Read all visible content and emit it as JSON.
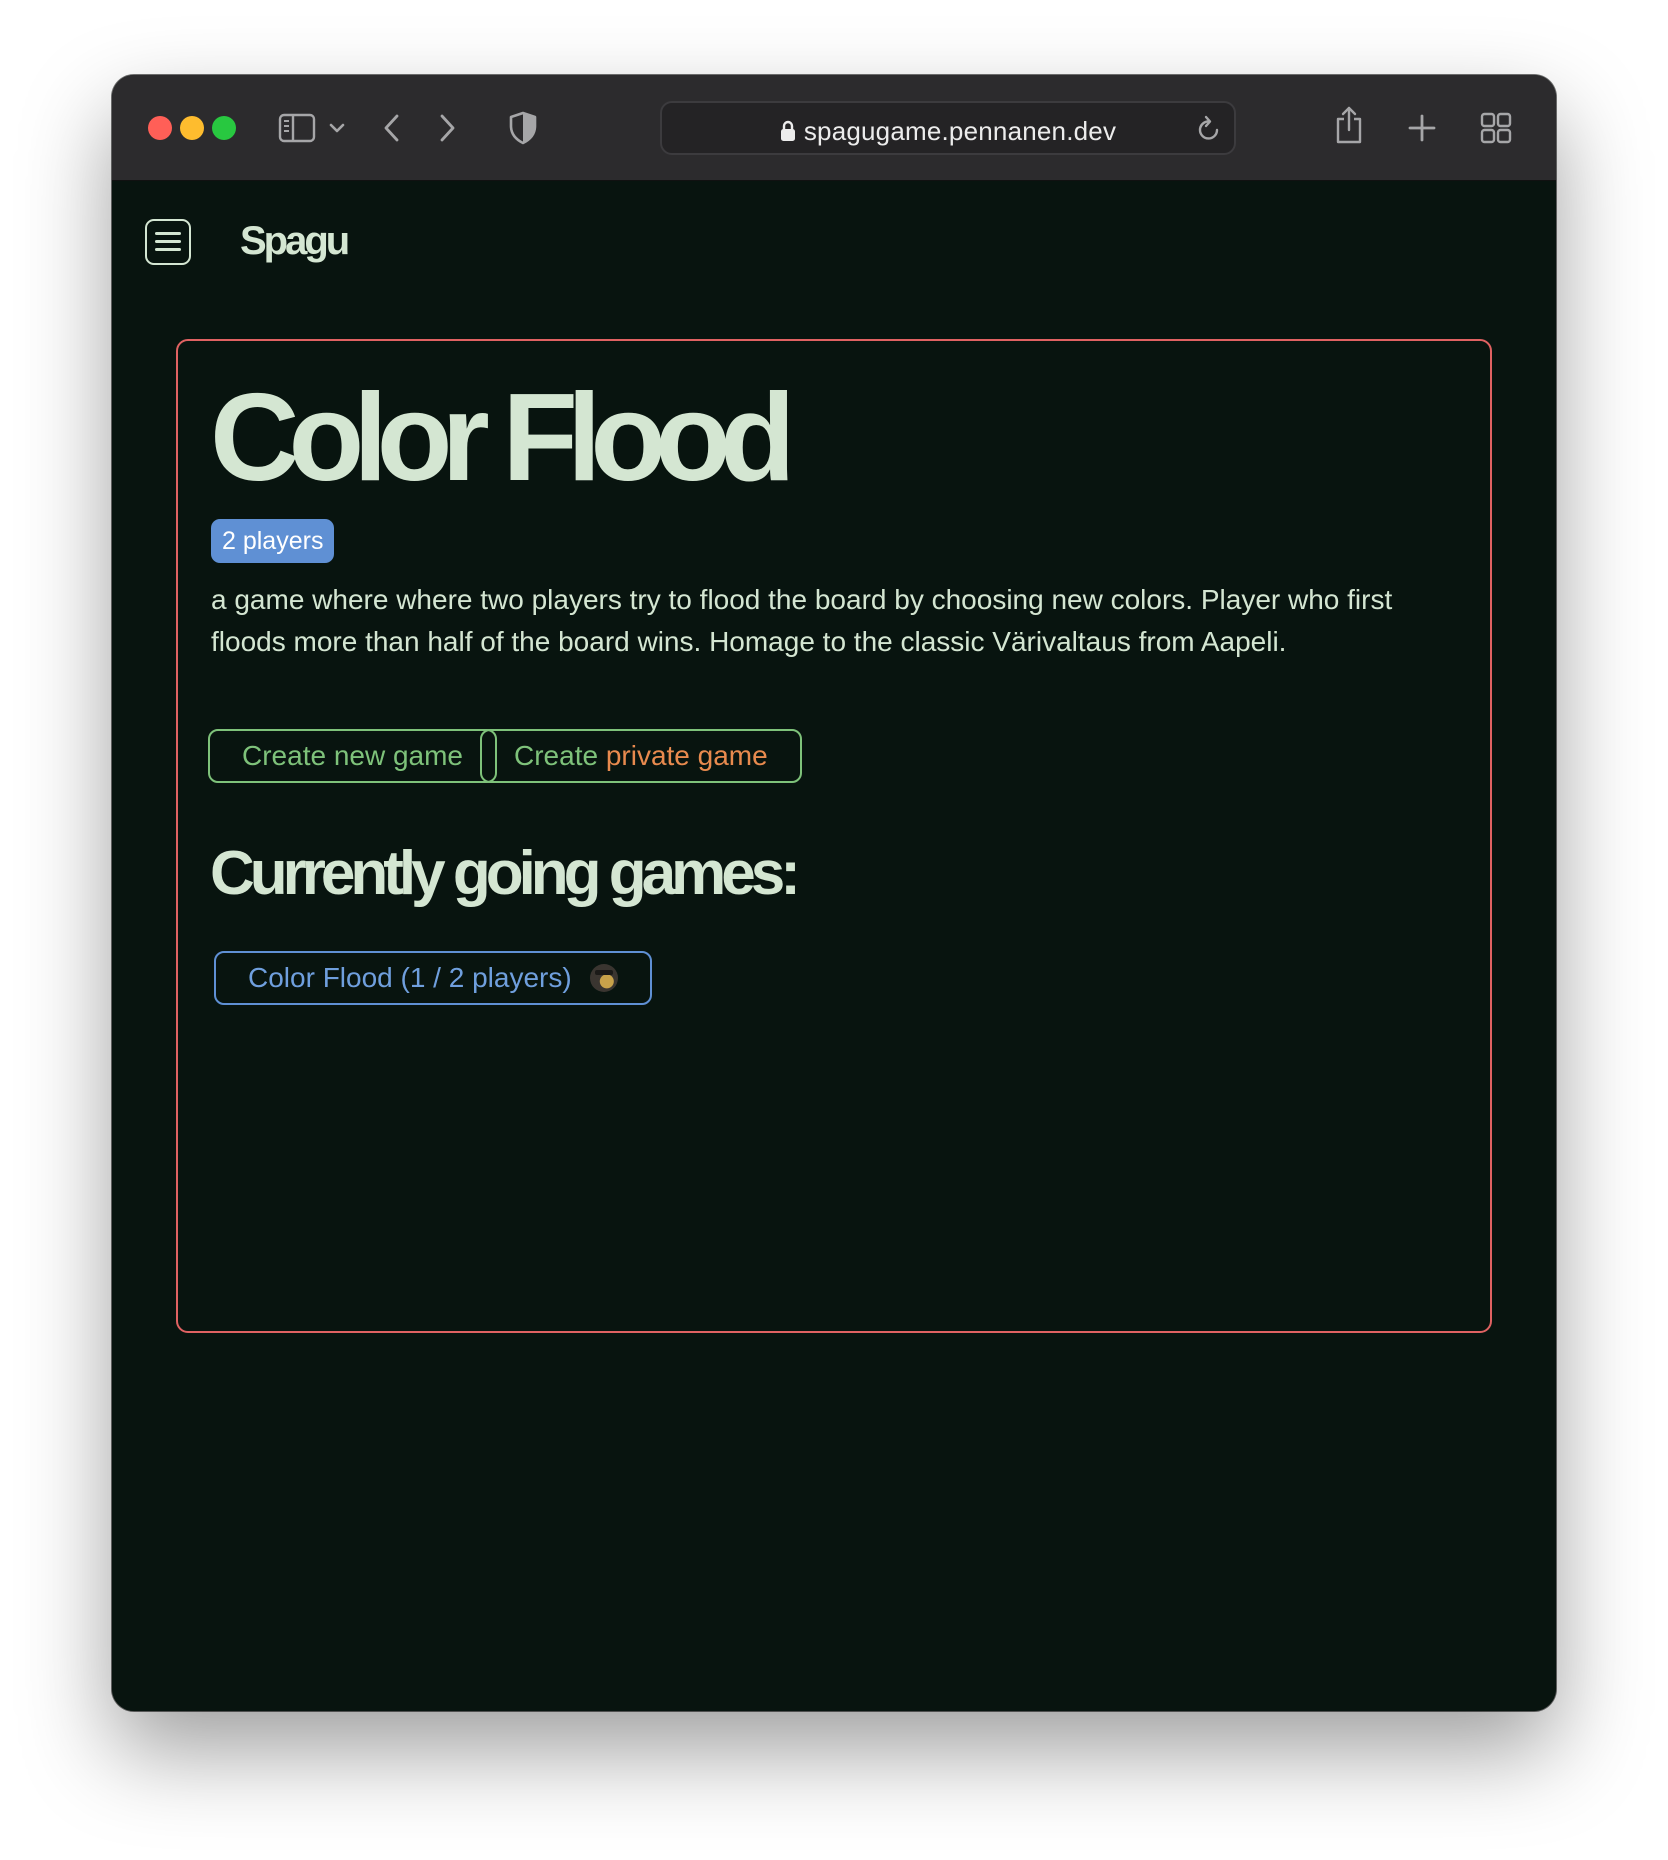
{
  "browser": {
    "url": "spagugame.pennanen.dev",
    "traffic_lights": {
      "close": "#ff5f57",
      "minimize": "#febc2e",
      "zoom": "#28c840"
    },
    "toolbar_icons": [
      "sidebar-icon",
      "chevron-down-icon",
      "back-arrow-icon",
      "forward-arrow-icon",
      "shield-icon",
      "lock-icon",
      "reload-icon",
      "share-icon",
      "plus-icon",
      "tab-overview-icon"
    ]
  },
  "header": {
    "brand": "Spagu",
    "menu_icon": "hamburger-menu-icon"
  },
  "game": {
    "title": "Color Flood",
    "players_badge": "2 players",
    "description": "a game where where two players try to flood the board by choosing new colors. Player who first floods more than half of the board wins. Homage to the classic Värivaltaus from Aapeli.",
    "create_button": "Create new game",
    "private_button_prefix": "Create",
    "private_button_accent": "private game",
    "current_heading": "Currently going games:",
    "current_games": [
      {
        "label": "Color Flood (1 / 2 players)"
      }
    ]
  },
  "colors": {
    "page_bg": "#08140f",
    "text": "#d4e6d2",
    "card_border": "#e06262",
    "badge_bg": "#5f90d4",
    "button_green": "#7ec27a",
    "accent_orange": "#e88a4e",
    "game_link_blue": "#6f9fdd"
  }
}
